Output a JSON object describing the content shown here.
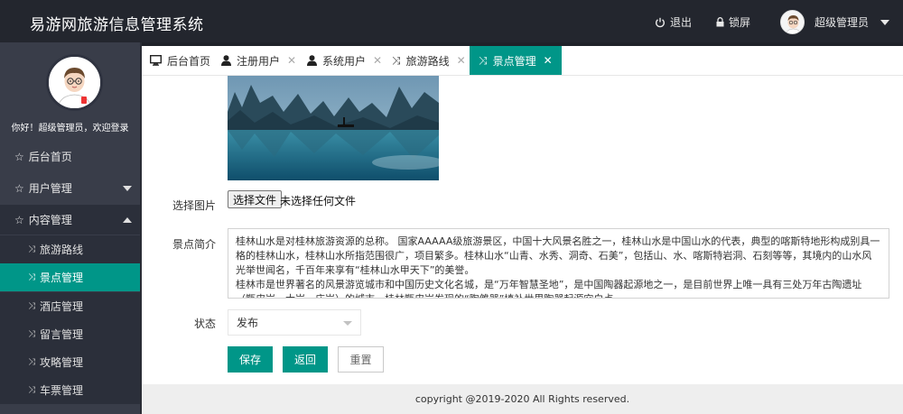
{
  "header": {
    "app_title": "易游网旅游信息管理系统",
    "logout_label": "退出",
    "lock_label": "锁屏",
    "user_label": "超级管理员"
  },
  "sidebar": {
    "welcome": "你好！超级管理员，欢迎登录",
    "nav": [
      {
        "label": "后台首页",
        "icon": "star-outline-icon"
      },
      {
        "label": "用户管理",
        "icon": "star-outline-icon",
        "expanded": false
      },
      {
        "label": "内容管理",
        "icon": "star-outline-icon",
        "expanded": true
      }
    ],
    "sub_items": [
      {
        "label": "旅游路线",
        "icon": "shuffle-icon",
        "active": false
      },
      {
        "label": "景点管理",
        "icon": "shuffle-icon",
        "active": true
      },
      {
        "label": "酒店管理",
        "icon": "shuffle-icon",
        "active": false
      },
      {
        "label": "留言管理",
        "icon": "shuffle-icon",
        "active": false
      },
      {
        "label": "攻略管理",
        "icon": "shuffle-icon",
        "active": false
      },
      {
        "label": "车票管理",
        "icon": "shuffle-icon",
        "active": false
      }
    ]
  },
  "tabs": [
    {
      "label": "后台首页",
      "icon": "monitor-icon",
      "closable": false,
      "active": false
    },
    {
      "label": "注册用户",
      "icon": "user-icon",
      "closable": true,
      "active": false
    },
    {
      "label": "系统用户",
      "icon": "user-icon",
      "closable": true,
      "active": false
    },
    {
      "label": "旅游路线",
      "icon": "shuffle-icon",
      "closable": true,
      "active": false
    },
    {
      "label": "景点管理",
      "icon": "shuffle-icon",
      "closable": true,
      "active": true
    }
  ],
  "form": {
    "image_label": "选择图片",
    "file_button": "选择文件",
    "file_status": "未选择任何文件",
    "intro_label": "景点简介",
    "intro_text": "桂林山水是对桂林旅游资源的总称。 国家AAAAA级旅游景区，中国十大风景名胜之一，桂林山水是中国山水的代表，典型的喀斯特地形构成别具一格的桂林山水，桂林山水所指范围很广，项目繁多。桂林山水“山青、水秀、洞奇、石美”，包括山、水、喀斯特岩洞、石刻等等，其境内的山水风光举世闻名，千百年来享有“桂林山水甲天下”的美誉。\n桂林市是世界著名的风景游览城市和中国历史文化名城，是“万年智慧圣地”，是中国陶器起源地之一，是目前世界上唯一具有三处万年古陶遗址（甑皮岩、大岩、庙岩）的城市，桂林甑皮岩发现的“陶雏器”填补世界陶器起源空白点",
    "status_label": "状态",
    "status_value": "发布",
    "save_label": "保存",
    "back_label": "返回",
    "reset_label": "重置"
  },
  "footer": {
    "copyright": "copyright @2019-2020 All Rights reserved."
  },
  "colors": {
    "accent": "#009688",
    "header_bg": "#23262e",
    "sidebar_bg": "#393d49"
  }
}
